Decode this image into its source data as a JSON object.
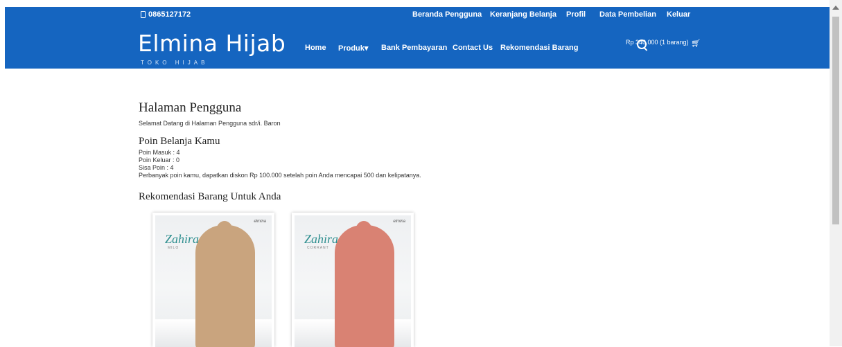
{
  "topbar": {
    "phone": "0865127172",
    "links": [
      "Beranda Pengguna",
      "Keranjang Belanja",
      "Profil",
      "Data Pembelian",
      "Keluar"
    ]
  },
  "brand": {
    "title": "Elmina Hijab",
    "subtitle": "TOKO HIJAB"
  },
  "nav": {
    "home": "Home",
    "produk": "Produk",
    "bank": "Bank Pembayaran",
    "contact": "Contact Us",
    "rekomendasi": "Rekomendasi Barang"
  },
  "cart": {
    "summary": "Rp 340.000 (1 barang)"
  },
  "page": {
    "title": "Halaman Pengguna",
    "welcome": "Selamat Datang di Halaman Pengguna sdr/i. Baron",
    "poin_title": "Poin Belanja Kamu",
    "poin_masuk": "Poin Masuk : 4",
    "poin_keluar": "Poin Keluar : 0",
    "sisa_poin": "Sisa Poin : 4",
    "info": "Perbanyak poin kamu, dapatkan diskon Rp 100.000 setelah poin Anda mencapai 500 dan kelipatanya.",
    "rekom_title": "Rekomendasi Barang Untuk Anda"
  },
  "products": [
    {
      "brand": "elmina",
      "name": "Zahira",
      "variant": "MILO",
      "color": "#c9a47e"
    },
    {
      "brand": "elmina",
      "name": "Zahira",
      "variant": "CORRANT",
      "color": "#d98273"
    }
  ],
  "colors": {
    "primary": "#1565c0"
  }
}
